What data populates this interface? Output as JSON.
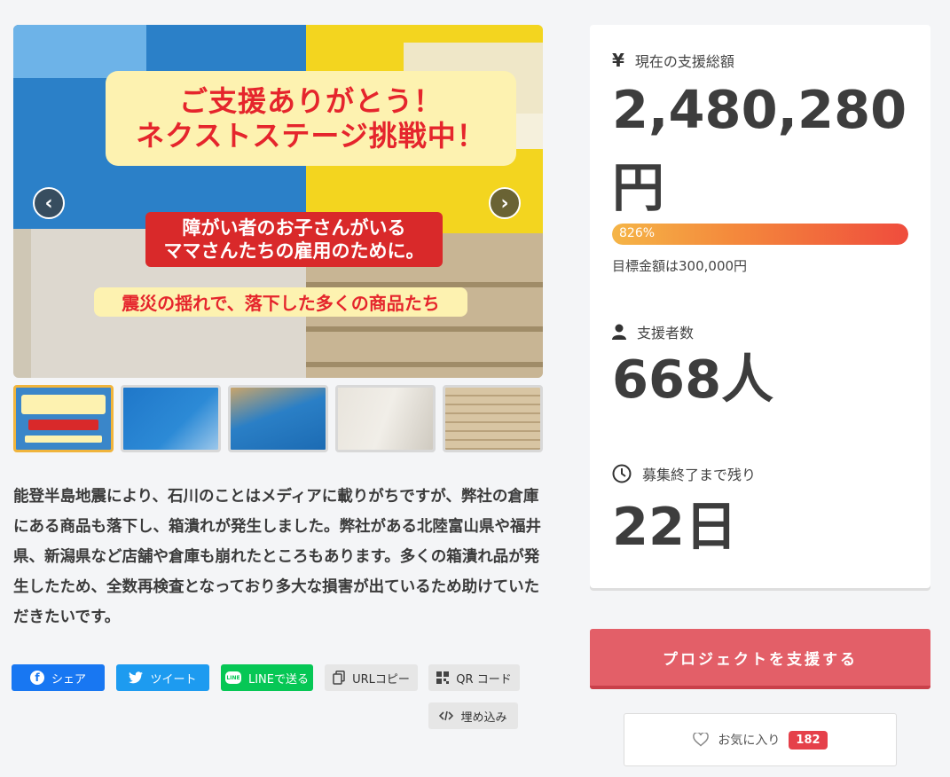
{
  "gallery": {
    "banner_line1": "ご支援ありがとう！",
    "banner_line2": "ネクストステージ挑戦中！",
    "red_line1": "障がい者のお子さんがいる",
    "red_line2": "ママさんたちの雇用のために。",
    "yellow_line": "震災の揺れで、落下した多くの商品たち",
    "prev_arrow": "‹",
    "next_arrow": "›"
  },
  "description": "能登半島地震により、石川のことはメディアに載りがちですが、弊社の倉庫にある商品も落下し、箱潰れが発生しました。弊社がある北陸富山県や福井県、新潟県など店舗や倉庫も崩れたところもあります。多くの箱潰れ品が発生したため、全数再検査となっており多大な損害が出ているため助けていただきたいです。",
  "share": {
    "facebook": "シェア",
    "twitter": "ツイート",
    "line": "LINEで送る",
    "url_copy": "URLコピー",
    "qr": "QR コード",
    "embed": "埋め込み"
  },
  "stats": {
    "total_label": "現在の支援総額",
    "total_amount": "2,480,280",
    "total_unit": "円",
    "progress_percent": 826,
    "progress_label": "826%",
    "goal_text": "目標金額は300,000円",
    "supporters_label": "支援者数",
    "supporters_value": "668人",
    "remaining_label": "募集終了まで残り",
    "remaining_value": "22日"
  },
  "actions": {
    "support_button": "プロジェクトを支援する",
    "favorite_label": "お気に入り",
    "favorite_count": "182"
  },
  "colors": {
    "support_button": "#e35f68",
    "progress_start": "#f5b547",
    "progress_end": "#ef4c3d",
    "favorite_badge": "#e5404a"
  }
}
